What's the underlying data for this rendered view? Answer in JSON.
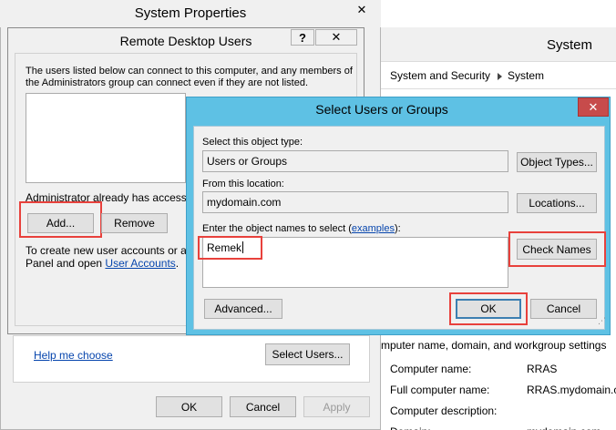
{
  "background_window": {
    "title": "System",
    "breadcrumb": [
      "System and Security",
      "System"
    ],
    "section_heading": "mputer name, domain, and workgroup settings",
    "rows": [
      {
        "label": "Computer name:",
        "value": "RRAS"
      },
      {
        "label": "Full computer name:",
        "value": "RRAS.mydomain.co"
      },
      {
        "label": "Computer description:",
        "value": ""
      },
      {
        "label": "Domain:",
        "value": "mydomain.com"
      }
    ]
  },
  "system_properties": {
    "title": "System Properties",
    "close_label": "✕",
    "help_link": "Help me choose",
    "select_users_label": "Select Users...",
    "ok_label": "OK",
    "cancel_label": "Cancel",
    "apply_label": "Apply"
  },
  "remote_desktop_users": {
    "title": "Remote Desktop Users",
    "help_label": "?",
    "close_label": "✕",
    "intro_text": "The users listed below can connect to this computer, and any members of the Administrators group can connect even if they are not listed.",
    "status_text": "Administrator already has access.",
    "add_label": "Add...",
    "remove_label": "Remove",
    "footer_text_1": "To create new user accounts or add",
    "footer_text_2": "Panel and open",
    "footer_link": "User Accounts",
    "footer_period": "."
  },
  "select_users": {
    "title": "Select Users or Groups",
    "close_label": "✕",
    "object_type_label": "Select this object type:",
    "object_type_value": "Users or Groups",
    "object_types_button": "Object Types...",
    "location_label": "From this location:",
    "location_value": "mydomain.com",
    "locations_button": "Locations...",
    "names_label_prefix": "Enter the object names to select (",
    "names_label_link": "examples",
    "names_label_suffix": "):",
    "names_value": "Remek",
    "check_names_button": "Check Names",
    "advanced_button": "Advanced...",
    "ok_button": "OK",
    "cancel_button": "Cancel"
  },
  "colors": {
    "highlight": "#e8413c",
    "dialog_accent": "#5ec1e4",
    "close_red": "#c74b4b",
    "link": "#0645ad"
  }
}
